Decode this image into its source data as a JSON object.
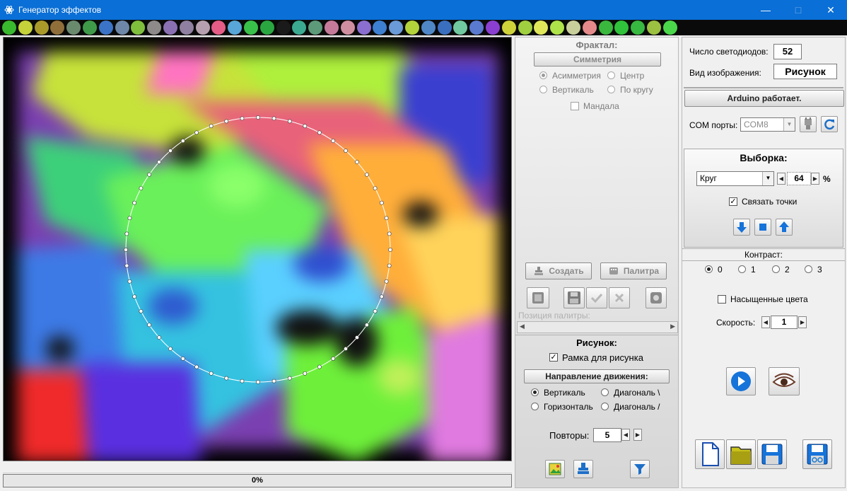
{
  "window": {
    "title": "Генератор эффектов",
    "minimize": "—",
    "maximize": "□",
    "close": "✕"
  },
  "palette": [
    "#39b92e",
    "#c5d23a",
    "#a99a2a",
    "#8f6e3a",
    "#6a8a6e",
    "#3e9a49",
    "#3b74c7",
    "#6e87a8",
    "#7fbf3c",
    "#8f8a8a",
    "#8b6fb3",
    "#8f7fa0",
    "#b6a0b0",
    "#e55c86",
    "#58a7d8",
    "#39c04a",
    "#2aa641",
    "#1a1a1a",
    "#3aa98f",
    "#5c9a7a",
    "#c57a9a",
    "#d08fa0",
    "#8a6fd0",
    "#3d7fd0",
    "#6a9ad8",
    "#b4d23a",
    "#4f86c6",
    "#3a6fc0",
    "#70c9a0",
    "#5a7ad0",
    "#8a3fd0",
    "#cfd33a",
    "#a0d040",
    "#e0e85a",
    "#aee34a",
    "#c9cf9a",
    "#e58a8a",
    "#3ab83e",
    "#2fc23a",
    "#37b840",
    "#9cc040",
    "#4ad84a"
  ],
  "preview": {
    "progress_percent": 0,
    "progress_text": "0%"
  },
  "fractal": {
    "title": "Фрактал:",
    "symmetry_button": "Симметрия",
    "options": [
      "Асимметрия",
      "Центр",
      "Вертикаль",
      "По кругу"
    ],
    "selected": "Асимметрия",
    "mandala_label": "Мандала",
    "mandala_checked": false
  },
  "actions": {
    "create_label": "Создать",
    "palette_label": "Палитра",
    "palette_position_label": "Позиция палитры:"
  },
  "picture": {
    "title": "Рисунок:",
    "frame_label": "Рамка для рисунка",
    "frame_checked": true,
    "direction_button": "Направление движения:",
    "directions": [
      "Вертикаль",
      "Диагональ \\",
      "Горизонталь",
      "Диагональ /"
    ],
    "selected_direction": "Вертикаль",
    "repeats_label": "Повторы:",
    "repeats_value": "5"
  },
  "leds": {
    "count_label": "Число светодиодов:",
    "count_value": "52",
    "view_label": "Вид изображения:",
    "view_value": "Рисунок"
  },
  "arduino": {
    "status": "Arduino работает.",
    "com_label": "COM порты:",
    "com_value": "COM8"
  },
  "sampling": {
    "title": "Выборка:",
    "shape_value": "Круг",
    "percent_value": "64",
    "percent_unit": "%",
    "connect_label": "Связать точки",
    "connect_checked": true
  },
  "contrast": {
    "title": "Контраст:",
    "options": [
      "0",
      "1",
      "2",
      "3"
    ],
    "selected": "0"
  },
  "saturated": {
    "label": "Насыщенные цвета",
    "checked": false
  },
  "speed": {
    "label": "Скорость:",
    "value": "1"
  },
  "colors": {
    "accent": "#0a6fd6",
    "blue_icon": "#1673d9",
    "yellow_icon": "#c8c21a"
  }
}
